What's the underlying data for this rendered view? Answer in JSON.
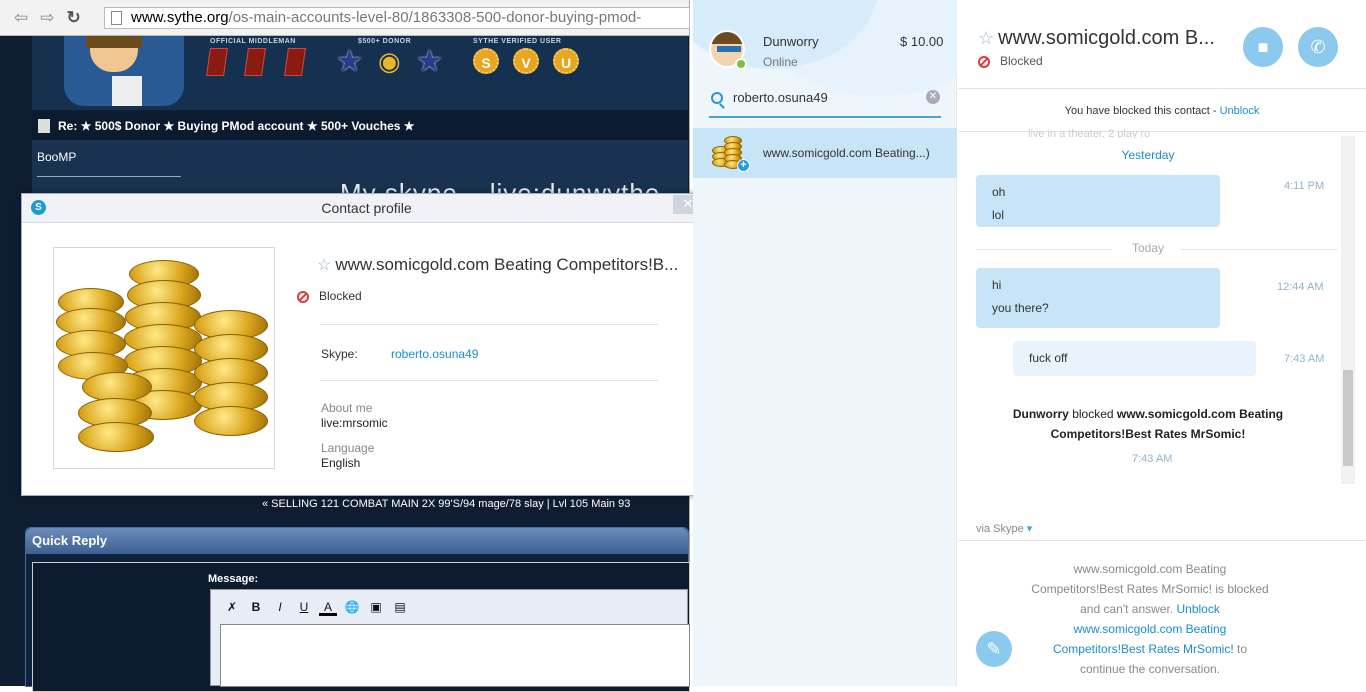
{
  "browser": {
    "url_host": "www.sythe.org",
    "url_path": "/os-main-accounts-level-80/1863308-500-donor-buying-pmod-",
    "badges": {
      "middleman": "OFFICIAL MIDDLEMAN",
      "donor": "$500+ DONOR",
      "verified": "SYTHE VERIFIED USER",
      "verified_letters": [
        "S",
        "V",
        "U"
      ]
    },
    "post_title": "Re: ★ 500$ Donor ★ Buying PMod account ★ 500+ Vouches ★",
    "username": "BooMP",
    "big_text": "My skype – live:dunwythe",
    "signature": "« SELLING 121 COMBAT MAIN 2X 99'S/94 mage/78 slay | Lvl 105 Main 93",
    "quick_reply": "Quick Reply",
    "message_label": "Message:",
    "toolbar": [
      "B",
      "I",
      "U",
      "A"
    ]
  },
  "contact_profile": {
    "window_title": "Contact profile",
    "close": "✕",
    "name": "www.somicgold.com Beating Competitors!B...",
    "status": "Blocked",
    "skype_label": "Skype:",
    "skype_value": "roberto.osuna49",
    "about_label": "About me",
    "about_value": "live:mrsomic",
    "language_label": "Language",
    "language_value": "English"
  },
  "skype": {
    "me": {
      "name": "Dunworry",
      "status": "Online",
      "credit": "$ 10.00"
    },
    "search_value": "roberto.osuna49",
    "result_name": "www.somicgold.com Beating...)",
    "chat": {
      "title": "www.somicgold.com B...",
      "status": "Blocked",
      "blocked_notice": "You have blocked this contact - ",
      "unblock": "Unblock",
      "faded_text": "live in a theater, 2 play ro",
      "day_yesterday": "Yesterday",
      "day_today": "Today",
      "messages": [
        {
          "lines": [
            "oh",
            "lol"
          ],
          "time": "4:11 PM"
        },
        {
          "lines": [
            "hi",
            "you there?"
          ],
          "time": "12:44 AM"
        },
        {
          "lines": [
            "fuck off"
          ],
          "time": "7:43 AM"
        }
      ],
      "sys_actor": "Dunworry",
      "sys_verb": " blocked ",
      "sys_target": "www.somicgold.com Beating Competitors!Best Rates MrSomic!",
      "sys_time": "7:43 AM",
      "via": "via Skype",
      "footer_pre": "www.somicgold.com Beating Competitors!Best Rates MrSomic! is blocked and can't answer.",
      "footer_link": "Unblock www.somicgold.com Beating Competitors!Best Rates MrSomic!",
      "footer_post": " to continue the conversation."
    }
  }
}
